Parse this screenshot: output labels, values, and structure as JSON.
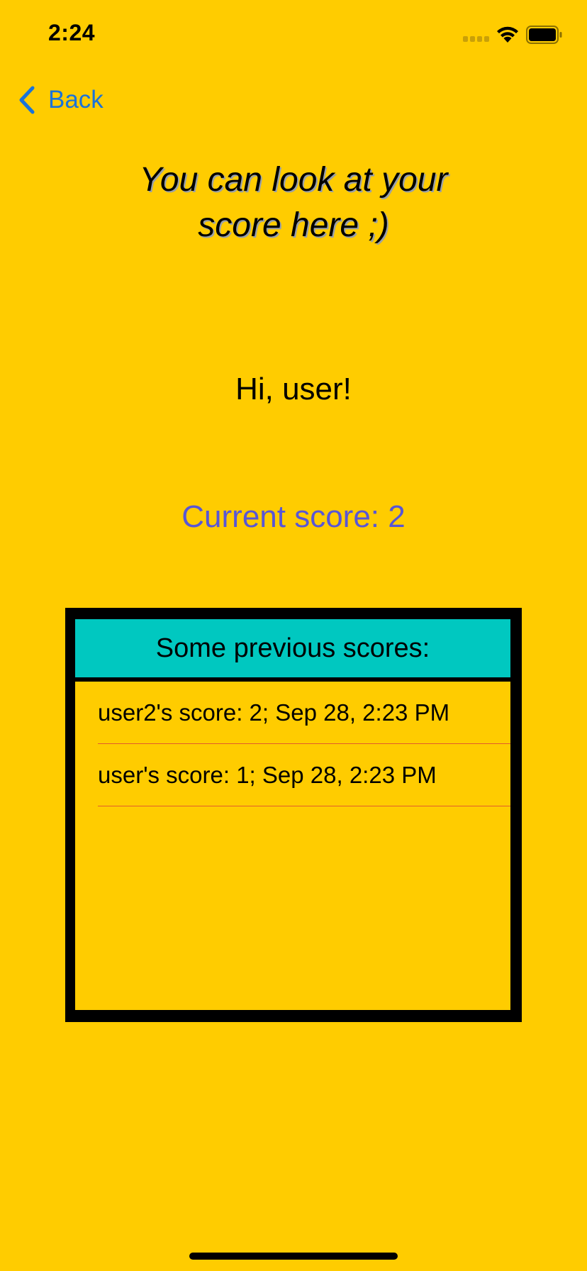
{
  "status_bar": {
    "time": "2:24"
  },
  "nav": {
    "back_label": "Back"
  },
  "title": "You can look at your score here ;)",
  "greeting": "Hi, user!",
  "current_score": "Current score: 2",
  "scores": {
    "header": "Some previous scores:",
    "rows": [
      "user2's score: 2; Sep 28, 2:23 PM",
      "user's score: 1; Sep 28, 2:23 PM"
    ]
  },
  "colors": {
    "background": "#FFCC00",
    "accent_link": "#1A73D9",
    "current_score": "#5856D6",
    "table_header": "#00C8C0",
    "separator": "#E25C2C"
  }
}
